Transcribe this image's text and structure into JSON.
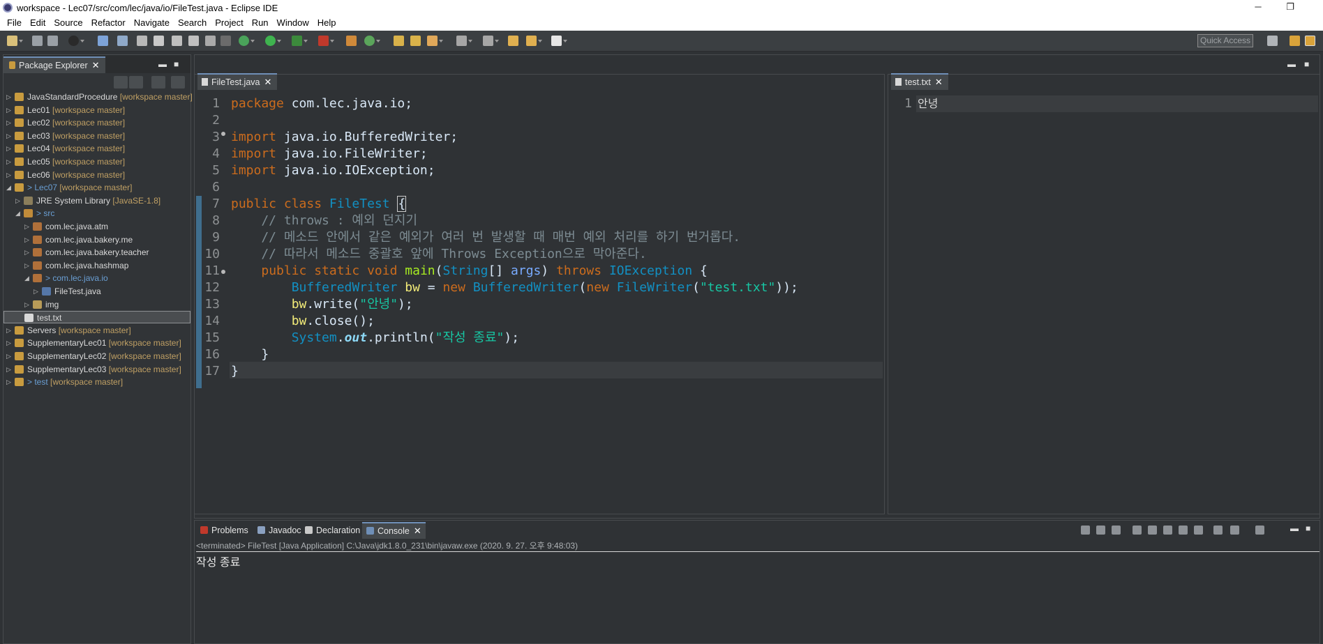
{
  "window": {
    "title": "workspace - Lec07/src/com/lec/java/io/FileTest.java - Eclipse IDE",
    "minimize": "─",
    "restore": "❐",
    "close": "✕"
  },
  "menu": [
    "File",
    "Edit",
    "Source",
    "Refactor",
    "Navigate",
    "Search",
    "Project",
    "Run",
    "Window",
    "Help"
  ],
  "toolbar": {
    "quick_access": "Quick Access"
  },
  "package_explorer": {
    "tab_label": "Package Explorer",
    "tree": [
      {
        "label": "JavaStandardProcedure",
        "decoration": "[workspace master]",
        "icon": "project-icon",
        "prefix": ""
      },
      {
        "label": "Lec01",
        "decoration": "[workspace master]",
        "icon": "project-icon",
        "prefix": ""
      },
      {
        "label": "Lec02",
        "decoration": "[workspace master]",
        "icon": "project-icon",
        "prefix": ""
      },
      {
        "label": "Lec03",
        "decoration": "[workspace master]",
        "icon": "project-icon",
        "prefix": ""
      },
      {
        "label": "Lec04",
        "decoration": "[workspace master]",
        "icon": "project-icon",
        "prefix": ""
      },
      {
        "label": "Lec05",
        "decoration": "[workspace master]",
        "icon": "project-icon",
        "prefix": ""
      },
      {
        "label": "Lec06",
        "decoration": "[workspace master]",
        "icon": "project-icon",
        "prefix": ""
      },
      {
        "label": "Lec07",
        "decoration": "[workspace master]",
        "icon": "project-icon",
        "prefix": "> "
      },
      {
        "label": "JRE System Library",
        "decoration": "[JavaSE-1.8]",
        "icon": "library-icon",
        "prefix": ""
      },
      {
        "label": "src",
        "decoration": "",
        "icon": "source-folder-icon",
        "prefix": "> "
      },
      {
        "label": "com.lec.java.atm",
        "decoration": "",
        "icon": "package-icon",
        "prefix": ""
      },
      {
        "label": "com.lec.java.bakery.me",
        "decoration": "",
        "icon": "package-icon",
        "prefix": ""
      },
      {
        "label": "com.lec.java.bakery.teacher",
        "decoration": "",
        "icon": "package-icon",
        "prefix": ""
      },
      {
        "label": "com.lec.java.hashmap",
        "decoration": "",
        "icon": "package-icon",
        "prefix": ""
      },
      {
        "label": "com.lec.java.io",
        "decoration": "",
        "icon": "package-icon",
        "prefix": "> "
      },
      {
        "label": "FileTest.java",
        "decoration": "",
        "icon": "java-file-icon",
        "prefix": ""
      },
      {
        "label": "img",
        "decoration": "",
        "icon": "folder-icon",
        "prefix": ""
      },
      {
        "label": "test.txt",
        "decoration": "",
        "icon": "text-file-icon",
        "prefix": ""
      },
      {
        "label": "Servers",
        "decoration": "[workspace master]",
        "icon": "project-icon",
        "prefix": ""
      },
      {
        "label": "SupplementaryLec01",
        "decoration": "[workspace master]",
        "icon": "project-icon",
        "prefix": ""
      },
      {
        "label": "SupplementaryLec02",
        "decoration": "[workspace master]",
        "icon": "project-icon",
        "prefix": ""
      },
      {
        "label": "SupplementaryLec03",
        "decoration": "[workspace master]",
        "icon": "project-icon",
        "prefix": ""
      },
      {
        "label": "test",
        "decoration": "[workspace master]",
        "icon": "project-icon",
        "prefix": "> "
      }
    ]
  },
  "editor": {
    "tab_label": "FileTest.java",
    "line_numbers": [
      "1",
      "2",
      "3",
      "4",
      "5",
      "6",
      "7",
      "8",
      "9",
      "10",
      "11",
      "12",
      "13",
      "14",
      "15",
      "16",
      "17"
    ],
    "code": {
      "l1_kw": "package",
      "l1_rest": " com.lec.java.io;",
      "l3_kw": "import",
      "l3_rest": " java.io.BufferedWriter;",
      "l4_kw": "import",
      "l4_rest": " java.io.FileWriter;",
      "l5_kw": "import",
      "l5_rest": " java.io.IOException;",
      "l7_kw": "public class",
      "l7_type": "FileTest",
      "l7_brace": "{",
      "l8": "    // throws : 예외 던지기",
      "l9": "    // 메소드 안에서 같은 예외가 여러 번 발생할 때 매번 예외 처리를 하기 번거롭다.",
      "l10": "    // 따라서 메소드 중괄호 앞에 Throws Exception으로 막아준다.",
      "l11_kw": "public static void",
      "l11_fn": "main",
      "l11_open": "(",
      "l11_type": "String",
      "l11_arr": "[] ",
      "l11_param": "args",
      "l11_close": ") ",
      "l11_throws": "throws",
      "l11_exc": "IOException",
      "l11_brace": " {",
      "l12_type": "BufferedWriter",
      "l12_var": "bw",
      "l12_eq": " = ",
      "l12_new": "new",
      "l12_type2": "BufferedWriter",
      "l12_p": "(",
      "l12_new2": "new",
      "l12_type3": "FileWriter",
      "l12_p2": "(",
      "l12_str": "\"test.txt\"",
      "l12_end": "));",
      "l13_var": "bw",
      "l13_mid": ".write(",
      "l13_str": "\"안녕\"",
      "l13_end": ");",
      "l14_var": "bw",
      "l14_end": ".close();",
      "l15_type": "System",
      "l15_dot": ".",
      "l15_field": "out",
      "l15_mid": ".println(",
      "l15_str": "\"작성 종료\"",
      "l15_end": ");",
      "l16": "}",
      "l17": "}"
    }
  },
  "text_editor": {
    "tab_label": "test.txt",
    "line_number": "1",
    "content": "안녕"
  },
  "console": {
    "tabs": [
      "Problems",
      "Javadoc",
      "Declaration",
      "Console"
    ],
    "status": "<terminated> FileTest [Java Application] C:\\Java\\jdk1.8.0_231\\bin\\javaw.exe (2020. 9. 27. 오후 9:48:03)",
    "output": "작성 종료"
  }
}
